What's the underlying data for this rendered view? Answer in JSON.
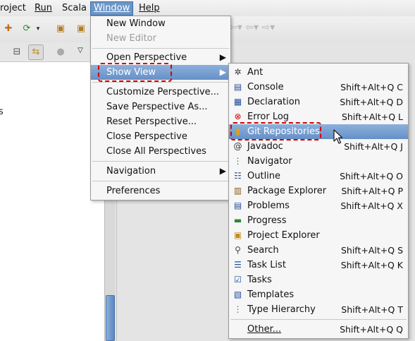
{
  "menubar": {
    "items": [
      {
        "label": "roject",
        "mnemonic": ""
      },
      {
        "label": "Run",
        "mnemonic": "R"
      },
      {
        "label": "Scala",
        "mnemonic": ""
      },
      {
        "label": "Window",
        "mnemonic": "W"
      },
      {
        "label": "Help",
        "mnemonic": "H"
      }
    ]
  },
  "left_view": {
    "fragment": "s"
  },
  "window_menu": {
    "new_window": "New Window",
    "new_editor": "New Editor",
    "open_perspective": "Open Perspective",
    "show_view": "Show View",
    "customize_perspective": "Customize Perspective...",
    "save_perspective_as": "Save Perspective As...",
    "reset_perspective": "Reset Perspective...",
    "close_perspective": "Close Perspective",
    "close_all_perspectives": "Close All Perspectives",
    "navigation": "Navigation",
    "preferences": "Preferences"
  },
  "show_view_menu": {
    "items": [
      {
        "label": "Ant",
        "shortcut": "",
        "icon": "ant-icon"
      },
      {
        "label": "Console",
        "shortcut": "Shift+Alt+Q C",
        "icon": "console-icon"
      },
      {
        "label": "Declaration",
        "shortcut": "Shift+Alt+Q D",
        "icon": "declaration-icon"
      },
      {
        "label": "Error Log",
        "shortcut": "Shift+Alt+Q L",
        "icon": "error-log-icon"
      },
      {
        "label": "Git Repositories",
        "shortcut": "",
        "icon": "git-repositories-icon"
      },
      {
        "label": "Javadoc",
        "shortcut": "Shift+Alt+Q J",
        "icon": "javadoc-icon"
      },
      {
        "label": "Navigator",
        "shortcut": "",
        "icon": "navigator-icon"
      },
      {
        "label": "Outline",
        "shortcut": "Shift+Alt+Q O",
        "icon": "outline-icon"
      },
      {
        "label": "Package Explorer",
        "shortcut": "Shift+Alt+Q P",
        "icon": "package-explorer-icon"
      },
      {
        "label": "Problems",
        "shortcut": "Shift+Alt+Q X",
        "icon": "problems-icon"
      },
      {
        "label": "Progress",
        "shortcut": "",
        "icon": "progress-icon"
      },
      {
        "label": "Project Explorer",
        "shortcut": "",
        "icon": "project-explorer-icon"
      },
      {
        "label": "Search",
        "shortcut": "Shift+Alt+Q S",
        "icon": "search-icon"
      },
      {
        "label": "Task List",
        "shortcut": "Shift+Alt+Q K",
        "icon": "task-list-icon"
      },
      {
        "label": "Tasks",
        "shortcut": "",
        "icon": "tasks-icon"
      },
      {
        "label": "Templates",
        "shortcut": "",
        "icon": "templates-icon"
      },
      {
        "label": "Type Hierarchy",
        "shortcut": "Shift+Alt+Q T",
        "icon": "type-hierarchy-icon"
      },
      {
        "label": "Other...",
        "shortcut": "Shift+Alt+Q Q",
        "icon": ""
      }
    ]
  },
  "colors": {
    "highlight": "#6d96c8",
    "callout": "#d40000"
  }
}
